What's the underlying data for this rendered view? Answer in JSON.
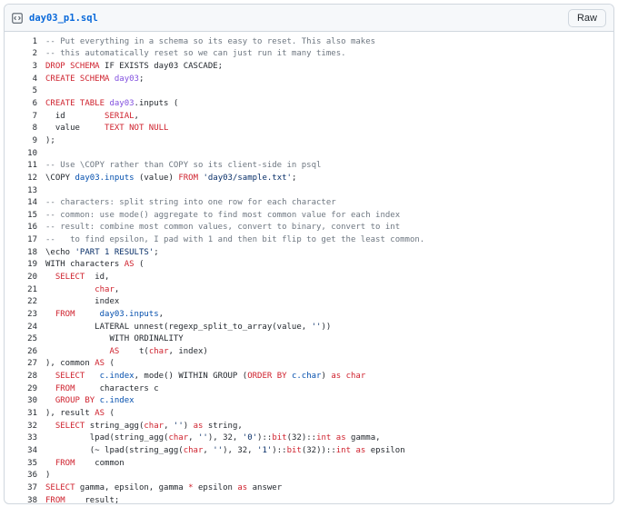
{
  "header": {
    "file_name": "day03_p1.sql",
    "raw_label": "Raw"
  },
  "icons": {
    "file": "code-file-icon"
  },
  "colors": {
    "comment": "#6e7781",
    "keyword": "#cf222e",
    "entity": "#8250df",
    "constant": "#0550ae",
    "string": "#0a3069",
    "plain": "#24292f",
    "link": "#0969da"
  },
  "lines": [
    {
      "n": "1",
      "t": [
        [
          "c",
          "-- Put everything in a schema so its easy to reset. This also makes"
        ]
      ]
    },
    {
      "n": "2",
      "t": [
        [
          "c",
          "-- this automatically reset so we can just run it many times."
        ]
      ]
    },
    {
      "n": "3",
      "t": [
        [
          "k",
          "DROP SCHEMA"
        ],
        [
          "p",
          " IF EXISTS day03 CASCADE;"
        ]
      ]
    },
    {
      "n": "4",
      "t": [
        [
          "k",
          "CREATE SCHEMA"
        ],
        [
          "p",
          " "
        ],
        [
          "e",
          "day03"
        ],
        [
          "p",
          ";"
        ]
      ]
    },
    {
      "n": "5",
      "t": [
        [
          "p",
          ""
        ]
      ]
    },
    {
      "n": "6",
      "t": [
        [
          "k",
          "CREATE TABLE"
        ],
        [
          "p",
          " "
        ],
        [
          "e",
          "day03"
        ],
        [
          "p",
          ".inputs ("
        ]
      ]
    },
    {
      "n": "7",
      "t": [
        [
          "p",
          "  id        "
        ],
        [
          "k",
          "SERIAL"
        ],
        [
          "p",
          ","
        ]
      ]
    },
    {
      "n": "8",
      "t": [
        [
          "p",
          "  value     "
        ],
        [
          "k",
          "TEXT NOT NULL"
        ]
      ]
    },
    {
      "n": "9",
      "t": [
        [
          "p",
          ");"
        ]
      ]
    },
    {
      "n": "10",
      "t": [
        [
          "p",
          ""
        ]
      ]
    },
    {
      "n": "11",
      "t": [
        [
          "c",
          "-- Use \\COPY rather than COPY so its client-side in psql"
        ]
      ]
    },
    {
      "n": "12",
      "t": [
        [
          "p",
          "\\COPY "
        ],
        [
          "o",
          "day03.inputs"
        ],
        [
          "p",
          " (value) "
        ],
        [
          "k",
          "FROM"
        ],
        [
          "p",
          " "
        ],
        [
          "s",
          "'day03/sample.txt'"
        ],
        [
          "p",
          ";"
        ]
      ]
    },
    {
      "n": "13",
      "t": [
        [
          "p",
          ""
        ]
      ]
    },
    {
      "n": "14",
      "t": [
        [
          "c",
          "-- characters: split string into one row for each character"
        ]
      ]
    },
    {
      "n": "15",
      "t": [
        [
          "c",
          "-- common: use mode() aggregate to find most common value for each index"
        ]
      ]
    },
    {
      "n": "16",
      "t": [
        [
          "c",
          "-- result: combine most common values, convert to binary, convert to int"
        ]
      ]
    },
    {
      "n": "17",
      "t": [
        [
          "c",
          "--   to find epsilon, I pad with 1 and then bit flip to get the least common."
        ]
      ]
    },
    {
      "n": "18",
      "t": [
        [
          "p",
          "\\echo "
        ],
        [
          "s",
          "'PART 1 RESULTS'"
        ],
        [
          "p",
          ";"
        ]
      ]
    },
    {
      "n": "19",
      "t": [
        [
          "p",
          "WITH characters "
        ],
        [
          "k",
          "AS"
        ],
        [
          "p",
          " ("
        ]
      ]
    },
    {
      "n": "20",
      "t": [
        [
          "p",
          "  "
        ],
        [
          "k",
          "SELECT"
        ],
        [
          "p",
          "  id,"
        ]
      ]
    },
    {
      "n": "21",
      "t": [
        [
          "p",
          "          "
        ],
        [
          "k",
          "char"
        ],
        [
          "p",
          ","
        ]
      ]
    },
    {
      "n": "22",
      "t": [
        [
          "p",
          "          index"
        ]
      ]
    },
    {
      "n": "23",
      "t": [
        [
          "p",
          "  "
        ],
        [
          "k",
          "FROM"
        ],
        [
          "p",
          "     "
        ],
        [
          "o",
          "day03.inputs"
        ],
        [
          "p",
          ","
        ]
      ]
    },
    {
      "n": "24",
      "t": [
        [
          "p",
          "          LATERAL unnest(regexp_split_to_array(value, "
        ],
        [
          "s",
          "''"
        ],
        [
          "p",
          "))"
        ]
      ]
    },
    {
      "n": "25",
      "t": [
        [
          "p",
          "             WITH ORDINALITY"
        ]
      ]
    },
    {
      "n": "26",
      "t": [
        [
          "p",
          "             "
        ],
        [
          "k",
          "AS"
        ],
        [
          "p",
          "    t("
        ],
        [
          "k",
          "char"
        ],
        [
          "p",
          ", index)"
        ]
      ]
    },
    {
      "n": "27",
      "t": [
        [
          "p",
          "), common "
        ],
        [
          "k",
          "AS"
        ],
        [
          "p",
          " ("
        ]
      ]
    },
    {
      "n": "28",
      "t": [
        [
          "p",
          "  "
        ],
        [
          "k",
          "SELECT"
        ],
        [
          "p",
          "   "
        ],
        [
          "o",
          "c.index"
        ],
        [
          "p",
          ", mode() WITHIN GROUP ("
        ],
        [
          "k",
          "ORDER BY"
        ],
        [
          "p",
          " "
        ],
        [
          "o",
          "c.char"
        ],
        [
          "p",
          ") "
        ],
        [
          "k",
          "as"
        ],
        [
          "p",
          " "
        ],
        [
          "k",
          "char"
        ]
      ]
    },
    {
      "n": "29",
      "t": [
        [
          "p",
          "  "
        ],
        [
          "k",
          "FROM"
        ],
        [
          "p",
          "     characters c"
        ]
      ]
    },
    {
      "n": "30",
      "t": [
        [
          "p",
          "  "
        ],
        [
          "k",
          "GROUP BY"
        ],
        [
          "p",
          " "
        ],
        [
          "o",
          "c.index"
        ]
      ]
    },
    {
      "n": "31",
      "t": [
        [
          "p",
          "), result "
        ],
        [
          "k",
          "AS"
        ],
        [
          "p",
          " ("
        ]
      ]
    },
    {
      "n": "32",
      "t": [
        [
          "p",
          "  "
        ],
        [
          "k",
          "SELECT"
        ],
        [
          "p",
          " string_agg("
        ],
        [
          "k",
          "char"
        ],
        [
          "p",
          ", "
        ],
        [
          "s",
          "''"
        ],
        [
          "p",
          ") "
        ],
        [
          "k",
          "as"
        ],
        [
          "p",
          " string,"
        ]
      ]
    },
    {
      "n": "33",
      "t": [
        [
          "p",
          "         lpad(string_agg("
        ],
        [
          "k",
          "char"
        ],
        [
          "p",
          ", "
        ],
        [
          "s",
          "''"
        ],
        [
          "p",
          "), 32, "
        ],
        [
          "s",
          "'0'"
        ],
        [
          "p",
          "):"
        ],
        [
          "p",
          ":"
        ],
        [
          "k",
          "bit"
        ],
        [
          "p",
          "(32)::"
        ],
        [
          "k",
          "int"
        ],
        [
          "p",
          " "
        ],
        [
          "k",
          "as"
        ],
        [
          "p",
          " gamma,"
        ]
      ]
    },
    {
      "n": "34",
      "t": [
        [
          "p",
          "         (~ lpad(string_agg("
        ],
        [
          "k",
          "char"
        ],
        [
          "p",
          ", "
        ],
        [
          "s",
          "''"
        ],
        [
          "p",
          "), 32, "
        ],
        [
          "s",
          "'1'"
        ],
        [
          "p",
          "):"
        ],
        [
          "p",
          ":"
        ],
        [
          "k",
          "bit"
        ],
        [
          "p",
          "(32))::"
        ],
        [
          "k",
          "int"
        ],
        [
          "p",
          " "
        ],
        [
          "k",
          "as"
        ],
        [
          "p",
          " epsilon"
        ]
      ]
    },
    {
      "n": "35",
      "t": [
        [
          "p",
          "  "
        ],
        [
          "k",
          "FROM"
        ],
        [
          "p",
          "    common"
        ]
      ]
    },
    {
      "n": "36",
      "t": [
        [
          "p",
          ")"
        ]
      ]
    },
    {
      "n": "37",
      "t": [
        [
          "k",
          "SELECT"
        ],
        [
          "p",
          " gamma, epsilon, gamma "
        ],
        [
          "k",
          "*"
        ],
        [
          "p",
          " epsilon "
        ],
        [
          "k",
          "as"
        ],
        [
          "p",
          " answer"
        ]
      ]
    },
    {
      "n": "38",
      "t": [
        [
          "k",
          "FROM"
        ],
        [
          "p",
          "    result;"
        ]
      ]
    }
  ]
}
